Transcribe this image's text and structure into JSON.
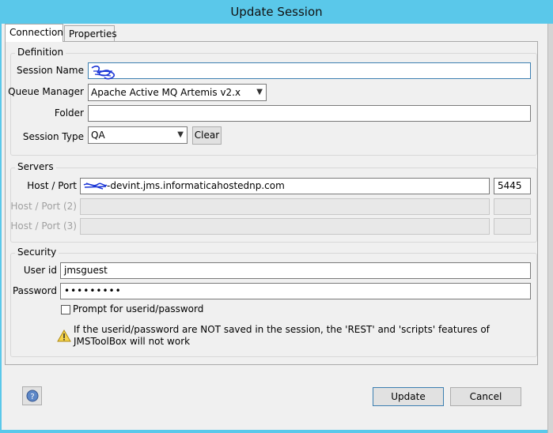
{
  "window": {
    "title": "Update Session"
  },
  "tabs": [
    {
      "label": "Connection",
      "active": true
    },
    {
      "label": "Properties",
      "active": false
    }
  ],
  "definition": {
    "group_label": "Definition",
    "session_name_label": "Session Name",
    "queue_manager_label": "Queue Manager",
    "queue_manager_value": "Apache Active MQ Artemis v2.x",
    "folder_label": "Folder",
    "folder_value": "",
    "session_type_label": "Session Type",
    "session_type_value": "QA",
    "clear_label": "Clear"
  },
  "servers": {
    "group_label": "Servers",
    "host_port_label": "Host / Port",
    "host_value": "-devint.jms.informaticahostednp.com",
    "port_value": "5445",
    "host_port_2_label": "Host / Port (2)",
    "host_port_3_label": "Host / Port (3)"
  },
  "security": {
    "group_label": "Security",
    "userid_label": "User id",
    "userid_value": "jmsguest",
    "password_label": "Password",
    "password_value": "•••••••••",
    "prompt_label": "Prompt for userid/password",
    "warning_text": "If the userid/password are NOT saved in the session, the 'REST' and 'scripts' features of JMSToolBox will not work"
  },
  "footer": {
    "update_label": "Update",
    "cancel_label": "Cancel",
    "help_icon": "question-mark-icon"
  },
  "colors": {
    "window_frame": "#5ac8ea",
    "dialog_bg": "#f0f0f0",
    "default_border": "#3c7fb1",
    "scribble": "#1a35d6"
  }
}
